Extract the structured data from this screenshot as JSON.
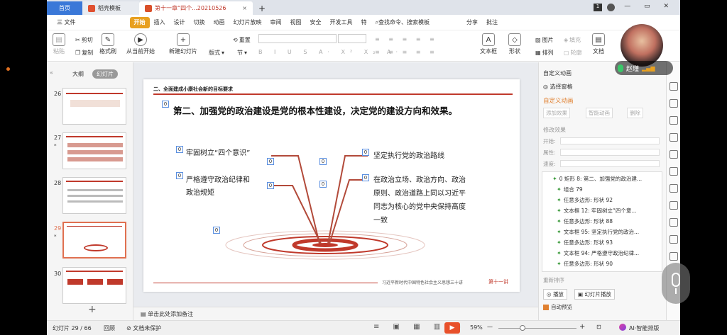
{
  "tabs": {
    "home": "首页",
    "template": "稻壳模板",
    "doc": "第十一章“四个...20210526",
    "add": "+"
  },
  "menu": [
    "三 文件",
    "开始",
    "插入",
    "设计",
    "切换",
    "动画",
    "幻灯片放映",
    "审阅",
    "视图",
    "安全",
    "开发工具",
    "特"
  ],
  "menu_active": "开始",
  "search": "查找命令、搜索模板",
  "top_right": {
    "share": "分享",
    "annotate": "批注",
    "user_name": "赵瑾"
  },
  "ribbon": {
    "paste": "粘贴",
    "cut": "剪切",
    "copy": "复制",
    "format_painter": "格式刷",
    "from_start": "从当前开始",
    "new_slide": "新建幻灯片",
    "layout": "版式",
    "section": "节",
    "reset": "重置",
    "textbox": "文本框",
    "shape": "形状",
    "arrange": "排列",
    "outline": "轮廓",
    "picture": "图片",
    "fill": "填充",
    "docassist": "文档"
  },
  "left_panel": {
    "tab_outline": "大纲",
    "tab_slides": "幻灯片",
    "add": "+"
  },
  "thumbnails": [
    {
      "num": "26"
    },
    {
      "num": "27",
      "star": "*"
    },
    {
      "num": "28"
    },
    {
      "num": "29",
      "star": "*"
    },
    {
      "num": "30"
    }
  ],
  "slide": {
    "heading": "二、全面建成小康社会新的目标要求",
    "title": "第二、加强党的政治建设是党的根本性建设，决定党的建设方向和效果。",
    "left1": "牢固树立“四个意识”",
    "left2a": "严格遵守政治纪律和",
    "left2b": "政治规矩",
    "right1": "坚定执行党的政治路线",
    "right2": [
      "在政治立场、政治方向、政治",
      "原则、政治道路上同以习近平",
      "同志为核心的党中央保持高度",
      "一致"
    ],
    "footer": "习近平新时代中国特色社会主义思想三十讲",
    "footer_mark": "第十一讲",
    "badge": "0"
  },
  "notes": "单击此处添加备注",
  "right_panel": {
    "title": "自定义动画",
    "select_pane": "选择窗格",
    "section": "自定义动画",
    "add_effect": "添加效果",
    "smart_anim": "智能动画",
    "delete": "删除",
    "modify": "修改效果",
    "start": "开始:",
    "property": "属性:",
    "speed": "速度:",
    "items": [
      "0 矩形 8: 第二、加强党的政治建...",
      "组合 79",
      "任意多边形: 形状 92",
      "文本框 12: 牢固树立“四个意...",
      "任意多边形: 形状 88",
      "文本框 95: 坚定执行党的政治...",
      "任意多边形: 形状 93",
      "文本框 94: 严格遵守政治纪律...",
      "任意多边形: 形状 90"
    ],
    "reorder": "重新排序",
    "play": "播放",
    "slideshow": "幻灯片播放",
    "autopreview": "自动预览"
  },
  "status": {
    "slide": "幻灯片 29 / 66",
    "theme": "回顾",
    "protect": "文档未保护",
    "zoom": "59%",
    "ai": "AI·智能排版"
  },
  "colors": {
    "accent": "#e8a020",
    "red": "#c0392b",
    "badge_border": "#5a8fe0"
  }
}
